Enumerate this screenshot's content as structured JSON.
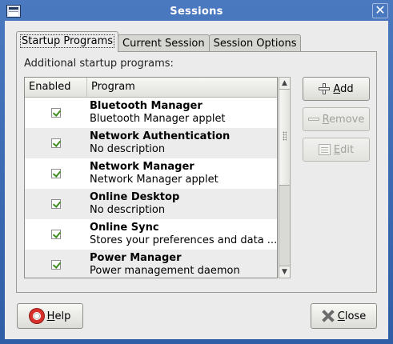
{
  "window": {
    "title": "Sessions",
    "close_glyph": "✕"
  },
  "tabs": [
    {
      "label": "Startup Programs",
      "active": true
    },
    {
      "label": "Current Session",
      "active": false
    },
    {
      "label": "Session Options",
      "active": false
    }
  ],
  "startup": {
    "section_label": "Additional startup programs:",
    "columns": {
      "enabled": "Enabled",
      "program": "Program"
    },
    "rows": [
      {
        "enabled": true,
        "name": "Bluetooth Manager",
        "description": "Bluetooth Manager applet"
      },
      {
        "enabled": true,
        "name": "Network Authentication",
        "description": "No description"
      },
      {
        "enabled": true,
        "name": "Network Manager",
        "description": "Network Manager applet"
      },
      {
        "enabled": true,
        "name": "Online Desktop",
        "description": "No description"
      },
      {
        "enabled": true,
        "name": "Online Sync",
        "description": "Stores your preferences and data ..."
      },
      {
        "enabled": true,
        "name": "Power Manager",
        "description": "Power management daemon"
      }
    ],
    "buttons": {
      "add": {
        "mnemonic": "A",
        "rest": "dd",
        "enabled": true
      },
      "remove": {
        "mnemonic": "R",
        "rest": "emove",
        "enabled": false
      },
      "edit": {
        "mnemonic": "E",
        "rest": "dit",
        "enabled": false
      }
    }
  },
  "footer": {
    "help": {
      "mnemonic": "H",
      "rest": "elp"
    },
    "close": {
      "mnemonic": "C",
      "rest": "lose"
    }
  },
  "icons": {
    "window_icon": "window-icon",
    "add": "plus-icon",
    "remove": "minus-icon",
    "edit": "edit-icon",
    "help": "lifebuoy-icon",
    "close": "close-x-icon"
  },
  "colors": {
    "titlebar": "#3e6cb5",
    "dialog_bg": "#ebebeb",
    "checkmark": "#3c8d1e",
    "disabled_text": "#a2a29d"
  }
}
